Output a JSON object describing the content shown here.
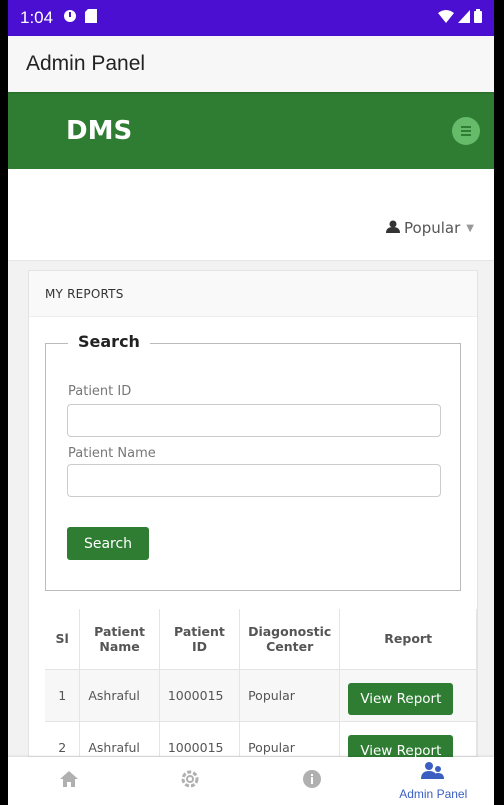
{
  "status_bar": {
    "time": "1:04",
    "bg": "#4a0fd0"
  },
  "app_bar": {
    "title": "Admin Panel"
  },
  "site": {
    "brand": "DMS",
    "brand_color": "#2e7d32",
    "user_menu": {
      "label": "Popular",
      "icon": "user-icon"
    }
  },
  "panel": {
    "heading": "MY REPORTS",
    "search": {
      "legend": "Search",
      "patient_id_label": "Patient ID",
      "patient_id_value": "",
      "patient_name_label": "Patient Name",
      "patient_name_value": "",
      "button_label": "Search"
    },
    "table": {
      "headers": [
        "Sl",
        "Patient Name",
        "Patient ID",
        "Diagonostic Center",
        "Report"
      ],
      "rows": [
        {
          "sl": "1",
          "name": "Ashraful",
          "id": "1000015",
          "center": "Popular",
          "report": "View Report"
        },
        {
          "sl": "2",
          "name": "Ashraful",
          "id": "1000015",
          "center": "Popular",
          "report": "View Report"
        }
      ]
    }
  },
  "bottom_nav": {
    "items": [
      {
        "icon": "home-icon",
        "label": ""
      },
      {
        "icon": "settings-icon",
        "label": ""
      },
      {
        "icon": "info-icon",
        "label": ""
      },
      {
        "icon": "admin-users-icon",
        "label": "Admin Panel"
      }
    ]
  }
}
